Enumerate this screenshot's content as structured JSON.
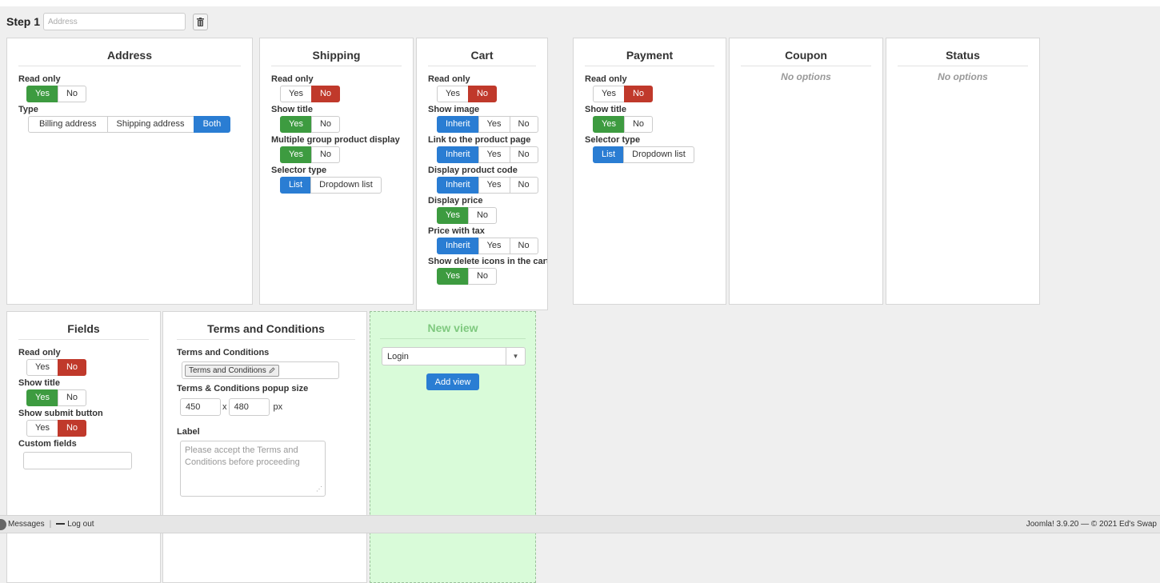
{
  "step": {
    "label": "Step 1",
    "placeholder": "Address"
  },
  "panels": {
    "address": {
      "title": "Address",
      "read_only": {
        "label": "Read only",
        "yes": "Yes",
        "no": "No"
      },
      "type": {
        "label": "Type",
        "options": [
          "Billing address",
          "Shipping address",
          "Both"
        ]
      }
    },
    "shipping": {
      "title": "Shipping",
      "read_only": {
        "label": "Read only",
        "yes": "Yes",
        "no": "No"
      },
      "show_title": {
        "label": "Show title",
        "yes": "Yes",
        "no": "No"
      },
      "multiple_group": {
        "label": "Multiple group product display",
        "yes": "Yes",
        "no": "No"
      },
      "selector_type": {
        "label": "Selector type",
        "list": "List",
        "dropdown": "Dropdown list"
      }
    },
    "cart": {
      "title": "Cart",
      "read_only": {
        "label": "Read only",
        "yes": "Yes",
        "no": "No"
      },
      "show_image": {
        "label": "Show image",
        "inherit": "Inherit",
        "yes": "Yes",
        "no": "No"
      },
      "link_product": {
        "label": "Link to the product page",
        "inherit": "Inherit",
        "yes": "Yes",
        "no": "No"
      },
      "product_code": {
        "label": "Display product code",
        "inherit": "Inherit",
        "yes": "Yes",
        "no": "No"
      },
      "display_price": {
        "label": "Display price",
        "yes": "Yes",
        "no": "No"
      },
      "price_tax": {
        "label": "Price with tax",
        "inherit": "Inherit",
        "yes": "Yes",
        "no": "No"
      },
      "delete_icons": {
        "label": "Show delete icons in the cart",
        "yes": "Yes",
        "no": "No"
      }
    },
    "payment": {
      "title": "Payment",
      "read_only": {
        "label": "Read only",
        "yes": "Yes",
        "no": "No"
      },
      "show_title": {
        "label": "Show title",
        "yes": "Yes",
        "no": "No"
      },
      "selector_type": {
        "label": "Selector type",
        "list": "List",
        "dropdown": "Dropdown list"
      }
    },
    "coupon": {
      "title": "Coupon",
      "empty": "No options"
    },
    "status": {
      "title": "Status",
      "empty": "No options"
    },
    "fields": {
      "title": "Fields",
      "read_only": {
        "label": "Read only",
        "yes": "Yes",
        "no": "No"
      },
      "show_title": {
        "label": "Show title",
        "yes": "Yes",
        "no": "No"
      },
      "show_submit": {
        "label": "Show submit button",
        "yes": "Yes",
        "no": "No"
      },
      "custom_fields": {
        "label": "Custom fields",
        "value": ""
      }
    },
    "terms": {
      "title": "Terms and Conditions",
      "field_label": "Terms and Conditions",
      "chip": "Terms and Conditions",
      "popup_label": "Terms & Conditions popup size",
      "width": "450",
      "sep": "x",
      "height": "480",
      "unit": "px",
      "label_label": "Label",
      "label_placeholder": "Please accept the Terms and Conditions before proceeding"
    },
    "new_view": {
      "title": "New view",
      "selected": "Login",
      "add_label": "Add view"
    }
  },
  "status_bar": {
    "messages": "Messages",
    "sep": "|",
    "logout": "Log out",
    "footer": "Joomla! 3.9.20 — © 2021 Ed's Swap"
  },
  "colors": {
    "yes_active": "#3d9b40",
    "no_active": "#c0392b",
    "blue_active": "#2a7dd3",
    "new_view_bg": "#d9fbd9"
  }
}
